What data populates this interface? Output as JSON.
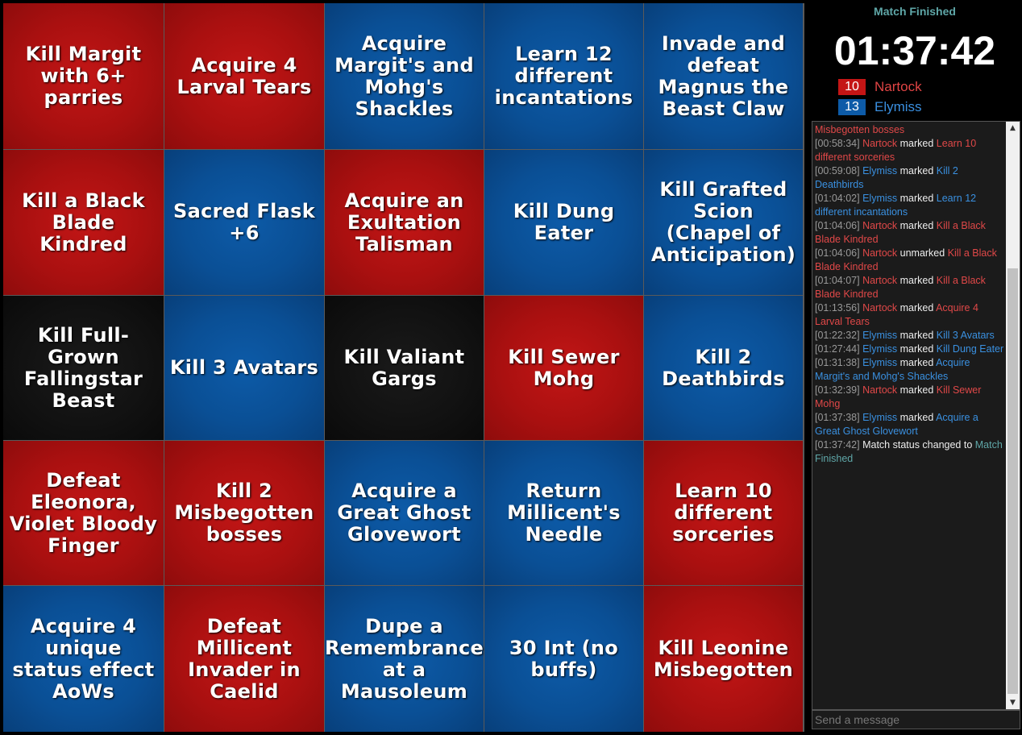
{
  "board": {
    "cells": [
      {
        "text": "Kill Margit with 6+ parries",
        "color": "red"
      },
      {
        "text": "Acquire 4 Larval Tears",
        "color": "red"
      },
      {
        "text": "Acquire Margit's and Mohg's Shackles",
        "color": "blue"
      },
      {
        "text": "Learn 12 different incantations",
        "color": "blue"
      },
      {
        "text": "Invade and defeat Magnus the Beast Claw",
        "color": "blue"
      },
      {
        "text": "Kill a Black Blade Kindred",
        "color": "red"
      },
      {
        "text": "Sacred Flask +6",
        "color": "blue"
      },
      {
        "text": "Acquire an Exultation Talisman",
        "color": "red"
      },
      {
        "text": "Kill Dung Eater",
        "color": "blue"
      },
      {
        "text": "Kill Grafted Scion (Chapel of Anticipation)",
        "color": "blue"
      },
      {
        "text": "Kill Full-Grown Fallingstar Beast",
        "color": "black"
      },
      {
        "text": "Kill 3 Avatars",
        "color": "blue"
      },
      {
        "text": "Kill Valiant Gargs",
        "color": "black"
      },
      {
        "text": "Kill Sewer Mohg",
        "color": "red"
      },
      {
        "text": "Kill 2 Deathbirds",
        "color": "blue"
      },
      {
        "text": "Defeat Eleonora, Violet Bloody Finger",
        "color": "red"
      },
      {
        "text": "Kill 2 Misbegotten bosses",
        "color": "red"
      },
      {
        "text": "Acquire a Great Ghost Glovewort",
        "color": "blue"
      },
      {
        "text": "Return Millicent's Needle",
        "color": "blue"
      },
      {
        "text": "Learn 10 different sorceries",
        "color": "red"
      },
      {
        "text": "Acquire 4 unique status effect AoWs",
        "color": "blue"
      },
      {
        "text": "Defeat Millicent Invader in Caelid",
        "color": "red"
      },
      {
        "text": "Dupe a Remembrance at a Mausoleum",
        "color": "blue"
      },
      {
        "text": "30 Int (no buffs)",
        "color": "blue"
      },
      {
        "text": "Kill Leonine Misbegotten",
        "color": "red"
      }
    ]
  },
  "sidebar": {
    "status": "Match Finished",
    "timer": "01:37:42",
    "players": [
      {
        "score": "10",
        "name": "Nartock",
        "color": "#c41515"
      },
      {
        "score": "13",
        "name": "Elymiss",
        "color": "#0d5ba8"
      }
    ],
    "chat_placeholder": "Send a message"
  },
  "chat_log": [
    {
      "parts": [
        {
          "t": "Misbegotten bosses",
          "c": "r"
        }
      ]
    },
    {
      "parts": [
        {
          "t": "[00:58:34] ",
          "c": "ts"
        },
        {
          "t": "Nartock",
          "c": "r"
        },
        {
          "t": " marked ",
          "c": "w"
        },
        {
          "t": "Learn 10 different sorceries",
          "c": "r"
        }
      ]
    },
    {
      "parts": [
        {
          "t": "[00:59:08] ",
          "c": "ts"
        },
        {
          "t": "Elymiss",
          "c": "b"
        },
        {
          "t": " marked ",
          "c": "w"
        },
        {
          "t": "Kill 2 Deathbirds",
          "c": "b"
        }
      ]
    },
    {
      "parts": [
        {
          "t": "[01:04:02] ",
          "c": "ts"
        },
        {
          "t": "Elymiss",
          "c": "b"
        },
        {
          "t": " marked ",
          "c": "w"
        },
        {
          "t": "Learn 12 different incantations",
          "c": "b"
        }
      ]
    },
    {
      "parts": [
        {
          "t": "[01:04:06] ",
          "c": "ts"
        },
        {
          "t": "Nartock",
          "c": "r"
        },
        {
          "t": " marked ",
          "c": "w"
        },
        {
          "t": "Kill a Black Blade Kindred",
          "c": "r"
        }
      ]
    },
    {
      "parts": [
        {
          "t": "[01:04:06] ",
          "c": "ts"
        },
        {
          "t": "Nartock",
          "c": "r"
        },
        {
          "t": " unmarked ",
          "c": "w"
        },
        {
          "t": "Kill a Black Blade Kindred",
          "c": "r"
        }
      ]
    },
    {
      "parts": [
        {
          "t": "[01:04:07] ",
          "c": "ts"
        },
        {
          "t": "Nartock",
          "c": "r"
        },
        {
          "t": " marked ",
          "c": "w"
        },
        {
          "t": "Kill a Black Blade Kindred",
          "c": "r"
        }
      ]
    },
    {
      "parts": [
        {
          "t": "[01:13:56] ",
          "c": "ts"
        },
        {
          "t": "Nartock",
          "c": "r"
        },
        {
          "t": " marked ",
          "c": "w"
        },
        {
          "t": "Acquire 4 Larval Tears",
          "c": "r"
        }
      ]
    },
    {
      "parts": [
        {
          "t": "[01:22:32] ",
          "c": "ts"
        },
        {
          "t": "Elymiss",
          "c": "b"
        },
        {
          "t": " marked ",
          "c": "w"
        },
        {
          "t": "Kill 3 Avatars",
          "c": "b"
        }
      ]
    },
    {
      "parts": [
        {
          "t": "[01:27:44] ",
          "c": "ts"
        },
        {
          "t": "Elymiss",
          "c": "b"
        },
        {
          "t": " marked ",
          "c": "w"
        },
        {
          "t": "Kill Dung Eater",
          "c": "b"
        }
      ]
    },
    {
      "parts": [
        {
          "t": "[01:31:38] ",
          "c": "ts"
        },
        {
          "t": "Elymiss",
          "c": "b"
        },
        {
          "t": " marked ",
          "c": "w"
        },
        {
          "t": "Acquire Margit's and Mohg's Shackles",
          "c": "b"
        }
      ]
    },
    {
      "parts": [
        {
          "t": "[01:32:39] ",
          "c": "ts"
        },
        {
          "t": "Nartock",
          "c": "r"
        },
        {
          "t": " marked ",
          "c": "w"
        },
        {
          "t": "Kill Sewer Mohg",
          "c": "r"
        }
      ]
    },
    {
      "parts": [
        {
          "t": "[01:37:38] ",
          "c": "ts"
        },
        {
          "t": "Elymiss",
          "c": "b"
        },
        {
          "t": " marked ",
          "c": "w"
        },
        {
          "t": "Acquire a Great Ghost Glovewort",
          "c": "b"
        }
      ]
    },
    {
      "parts": [
        {
          "t": "[01:37:42] ",
          "c": "ts"
        },
        {
          "t": "Match status changed to ",
          "c": "w"
        },
        {
          "t": "Match Finished",
          "c": "t"
        }
      ]
    }
  ],
  "icons": {
    "scroll_up": "scroll-up-arrow-icon",
    "scroll_down": "scroll-down-arrow-icon"
  }
}
